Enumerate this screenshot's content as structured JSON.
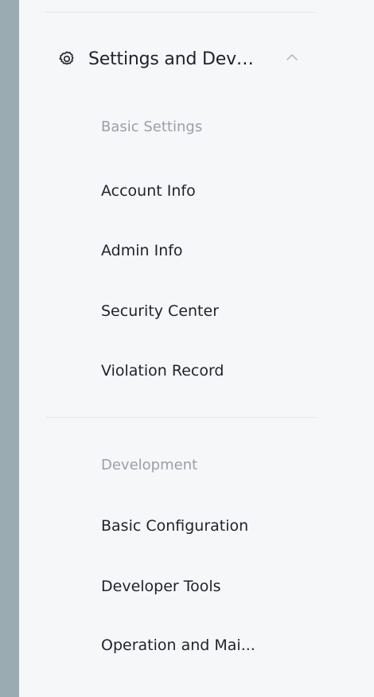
{
  "nav": {
    "section_title": "Settings and Dev…",
    "section_icon": "gear-icon",
    "collapse_icon": "chevron-up-icon",
    "groups": [
      {
        "label": "Basic Settings",
        "items": [
          "Account Info",
          "Admin Info",
          "Security Center",
          "Violation Record"
        ]
      },
      {
        "label": "Development",
        "items": [
          "Basic Configuration",
          "Developer Tools",
          "Operation and Mai..."
        ]
      }
    ]
  },
  "colors": {
    "background": "#9aabb2",
    "panel": "#f6f7f9",
    "text": "#1f2329",
    "muted": "#9a9fa6",
    "divider": "#e3e5e8"
  }
}
